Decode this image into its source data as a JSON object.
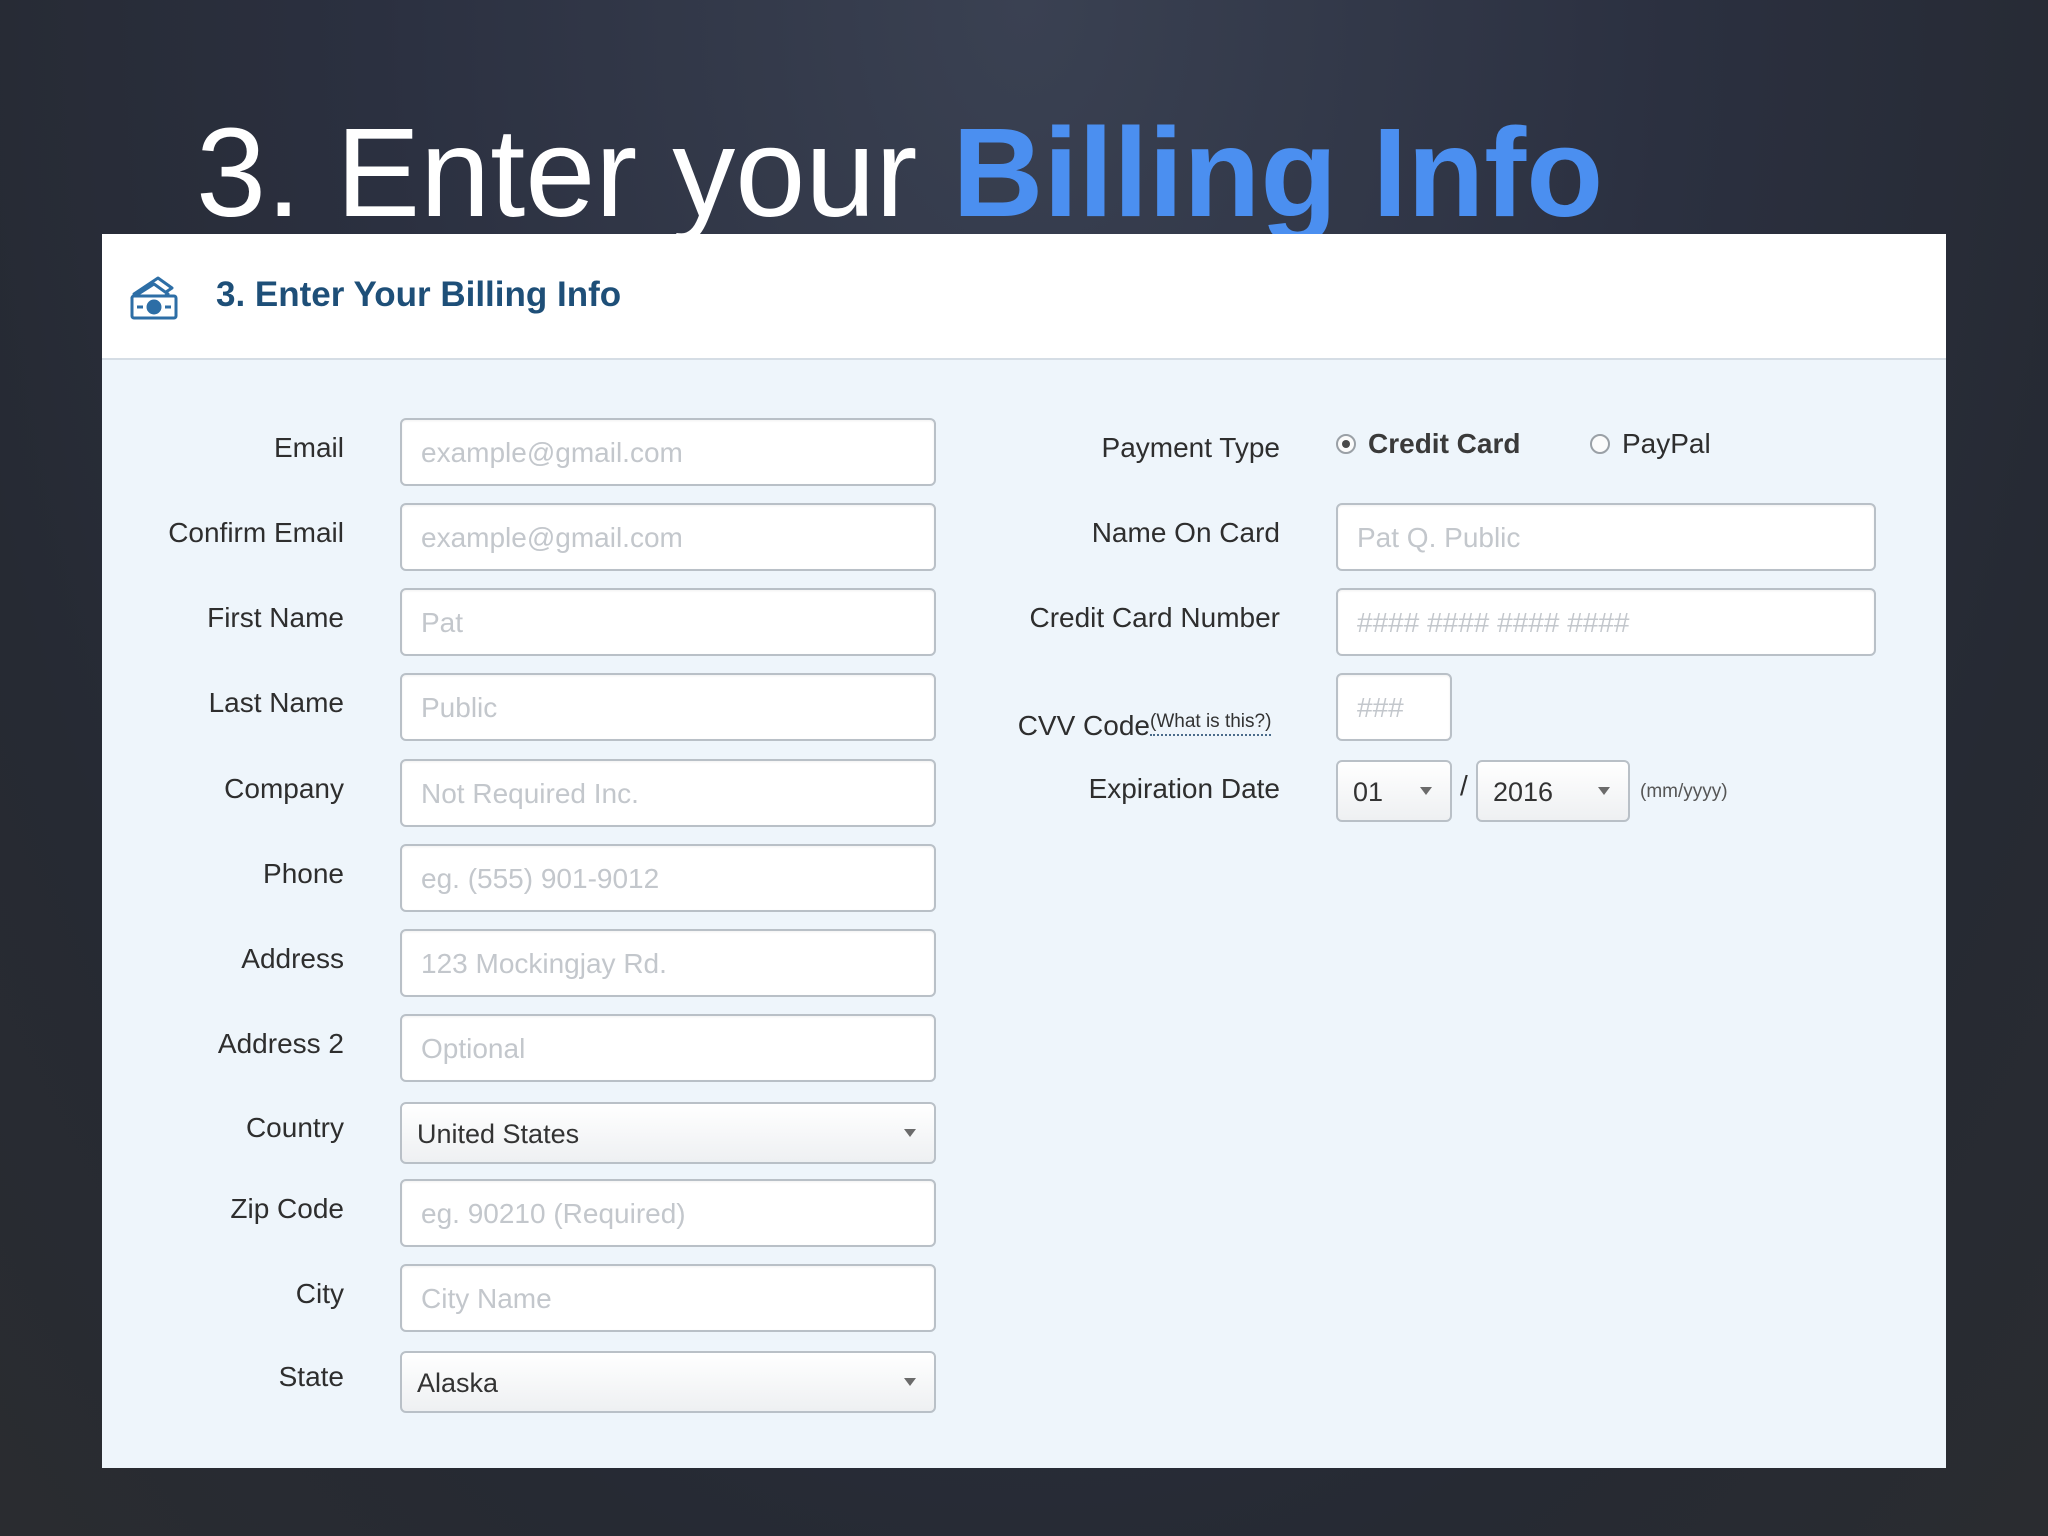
{
  "slide": {
    "title_prefix": "3. Enter your ",
    "title_accent": "Billing Info"
  },
  "panel": {
    "icon": "money-icon",
    "title": "3. Enter Your Billing Info"
  },
  "billing": {
    "email": {
      "label": "Email",
      "placeholder": "example@gmail.com"
    },
    "confirm_email": {
      "label": "Confirm Email",
      "placeholder": "example@gmail.com"
    },
    "first_name": {
      "label": "First Name",
      "placeholder": "Pat"
    },
    "last_name": {
      "label": "Last Name",
      "placeholder": "Public"
    },
    "company": {
      "label": "Company",
      "placeholder": "Not Required Inc."
    },
    "phone": {
      "label": "Phone",
      "placeholder": "eg. (555) 901-9012"
    },
    "address": {
      "label": "Address",
      "placeholder": "123 Mockingjay Rd."
    },
    "address2": {
      "label": "Address 2",
      "placeholder": "Optional"
    },
    "country": {
      "label": "Country",
      "value": "United States"
    },
    "zip": {
      "label": "Zip Code",
      "placeholder": "eg. 90210 (Required)"
    },
    "city": {
      "label": "City",
      "placeholder": "City Name"
    },
    "state": {
      "label": "State",
      "value": "Alaska"
    }
  },
  "payment": {
    "type_label": "Payment Type",
    "options": [
      "Credit Card",
      "PayPal"
    ],
    "selected": "Credit Card",
    "name_on_card": {
      "label": "Name On Card",
      "placeholder": "Pat Q. Public"
    },
    "card_number": {
      "label": "Credit Card Number",
      "placeholder": "#### #### #### ####"
    },
    "cvv": {
      "label": "CVV Code",
      "help_link": "(What is this?)",
      "placeholder": "###"
    },
    "expiration": {
      "label": "Expiration Date",
      "month": "01",
      "separator": "/",
      "year": "2016",
      "format_hint": "(mm/yyyy)"
    }
  },
  "colors": {
    "accent_blue": "#4b8ff0",
    "header_title": "#1e4f78",
    "panel_bg": "#eef5fb"
  }
}
